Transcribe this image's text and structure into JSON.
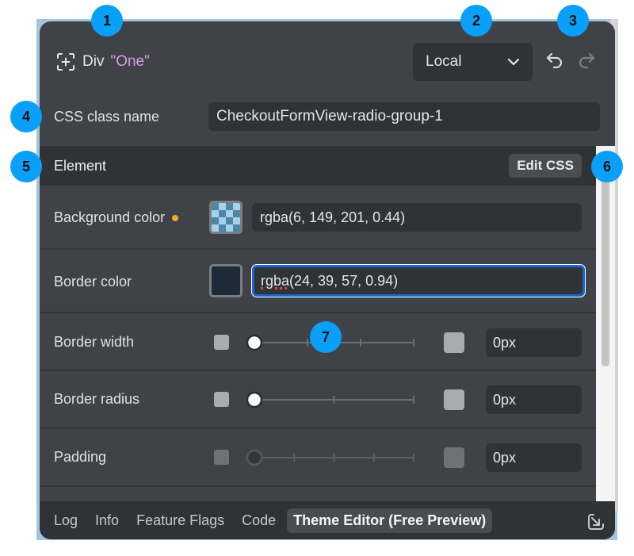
{
  "header": {
    "element_icon": "add-element-icon",
    "element_kind": "Div",
    "element_name": "\"One\"",
    "scope_select": {
      "value": "Local",
      "icon": "chevron-down-icon"
    },
    "undo_icon": "undo-icon",
    "redo_icon": "redo-icon"
  },
  "class_row": {
    "label": "CSS class name",
    "value": "CheckoutFormView-radio-group-1"
  },
  "section": {
    "title": "Element",
    "edit_css_label": "Edit CSS"
  },
  "properties": {
    "background_color": {
      "label": "Background color",
      "value": "rgba(6, 149, 201, 0.44)",
      "modified": true,
      "modified_color": "#f5a623",
      "swatch_color": "#0695c9"
    },
    "border_color": {
      "label": "Border color",
      "value_prefix": "rgba",
      "value_rest": "(24, 39, 57, 0.94)",
      "focused": true,
      "swatch_color": "#182739"
    },
    "border_width": {
      "label": "Border width",
      "value": "0px",
      "slider_position": 0,
      "slider_ticks": 3
    },
    "border_radius": {
      "label": "Border radius",
      "value": "0px",
      "slider_position": 0,
      "slider_ticks": 2
    },
    "padding": {
      "label": "Padding",
      "value": "0px",
      "slider_position": 0,
      "slider_ticks": 4,
      "disabled": true
    }
  },
  "footer": {
    "tabs": [
      {
        "label": "Log",
        "active": false
      },
      {
        "label": "Info",
        "active": false
      },
      {
        "label": "Feature Flags",
        "active": false
      },
      {
        "label": "Code",
        "active": false
      },
      {
        "label": "Theme Editor (Free Preview)",
        "active": true
      }
    ],
    "dock_icon": "dock-to-corner-icon"
  },
  "callouts": [
    "1",
    "2",
    "3",
    "4",
    "5",
    "6",
    "7"
  ],
  "colors": {
    "panel_bg": "#3f4347",
    "input_bg": "#2f3336",
    "accent_focus": "#1768d6",
    "callout": "#0aa0fa",
    "element_name": "#d99ce8"
  }
}
